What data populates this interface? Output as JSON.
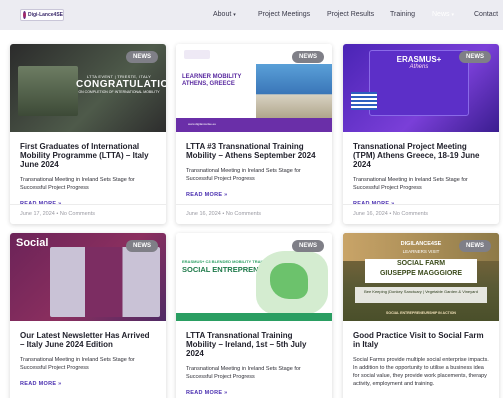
{
  "header": {
    "logo_text": "Digi-Lance4SE",
    "nav": [
      {
        "label": "About",
        "has_dropdown": true
      },
      {
        "label": "Project Meetings",
        "has_dropdown": false
      },
      {
        "label": "Project Results",
        "has_dropdown": false
      },
      {
        "label": "Training",
        "has_dropdown": false
      },
      {
        "label": "News",
        "has_dropdown": true,
        "active": true
      },
      {
        "label": "Contact",
        "has_dropdown": false
      }
    ]
  },
  "colors": {
    "read_more": "#4a2fb0",
    "badge": "#7f7f87",
    "header_bg": "#ececf2"
  },
  "cards": [
    {
      "badge": "NEWS",
      "thumb_text": {
        "line1": "LTTA EVENT | TRIESTE, ITALY",
        "line2": "CONGRATULATIONS",
        "line3": "ON COMPLETION OF INTERNATIONAL MOBILITY"
      },
      "title": "First Graduates of International Mobility Programme (LTTA) – Italy June 2024",
      "excerpt": "Transnational Meeting in Ireland Sets Stage for Successful Project Progress",
      "read_more": "READ MORE »",
      "date": "June 17, 2024",
      "comments": "No Comments"
    },
    {
      "badge": "NEWS",
      "thumb_text": {
        "line1": "LEARNER MOBILITY ATHENS, GREECE",
        "line2": "www.digilance4se.eu"
      },
      "title": "LTTA #3 Transnational Training Mobility – Athens September 2024",
      "excerpt": "Transnational Meeting in Ireland Sets Stage for Successful Project Progress",
      "read_more": "READ MORE »",
      "date": "June 16, 2024",
      "comments": "No Comments"
    },
    {
      "badge": "NEWS",
      "thumb_text": {
        "line1": "ERASMUS+",
        "line2": "Athens"
      },
      "title": "Transnational Project Meeting (TPM) Athens Greece, 18-19 June 2024",
      "excerpt": "Transnational Meeting in Ireland Sets Stage for Successful Project Progress",
      "read_more": "READ MORE »",
      "date": "June 16, 2024",
      "comments": "No Comments"
    },
    {
      "badge": "NEWS",
      "thumb_text": {
        "line1": "Social"
      },
      "title": "Our Latest Newsletter Has Arrived – Italy June 2024 Edition",
      "excerpt": "Transnational Meeting in Ireland Sets Stage for Successful Project Progress",
      "read_more": "READ MORE »"
    },
    {
      "badge": "NEWS",
      "thumb_text": {
        "line1": "ERASMUS+ C3 BLENDED MOBILITY TRAINING",
        "line2": "SOCIAL ENTREPRENEURSHIP"
      },
      "title": "LTTA Transnational Training Mobility – Ireland, 1st – 5th July 2024",
      "excerpt": "Transnational Meeting in Ireland Sets Stage for Successful Project Progress",
      "read_more": "READ MORE »"
    },
    {
      "badge": "NEWS",
      "thumb_text": {
        "line1": "DIGILANCE4SE",
        "line2": "LEARNERS VISIT",
        "line3": "SOCIAL FARM",
        "line4": "GIUSEPPE MAGGGIORE",
        "line5": "Bee Keeping |Donkey Sanctuary | Vegetable Garden & Vineyard",
        "line6": "SOCIAL ENTREPRENEURSHIP IN ACTION"
      },
      "title": "Good Practice Visit to Social Farm in Italy",
      "excerpt": "Social Farms provide multiple social enterprise impacts. In addition to the opportunity to utilise a business idea for social value, they provide work placements, therapy activity, employment and training.",
      "read_more": ""
    }
  ]
}
